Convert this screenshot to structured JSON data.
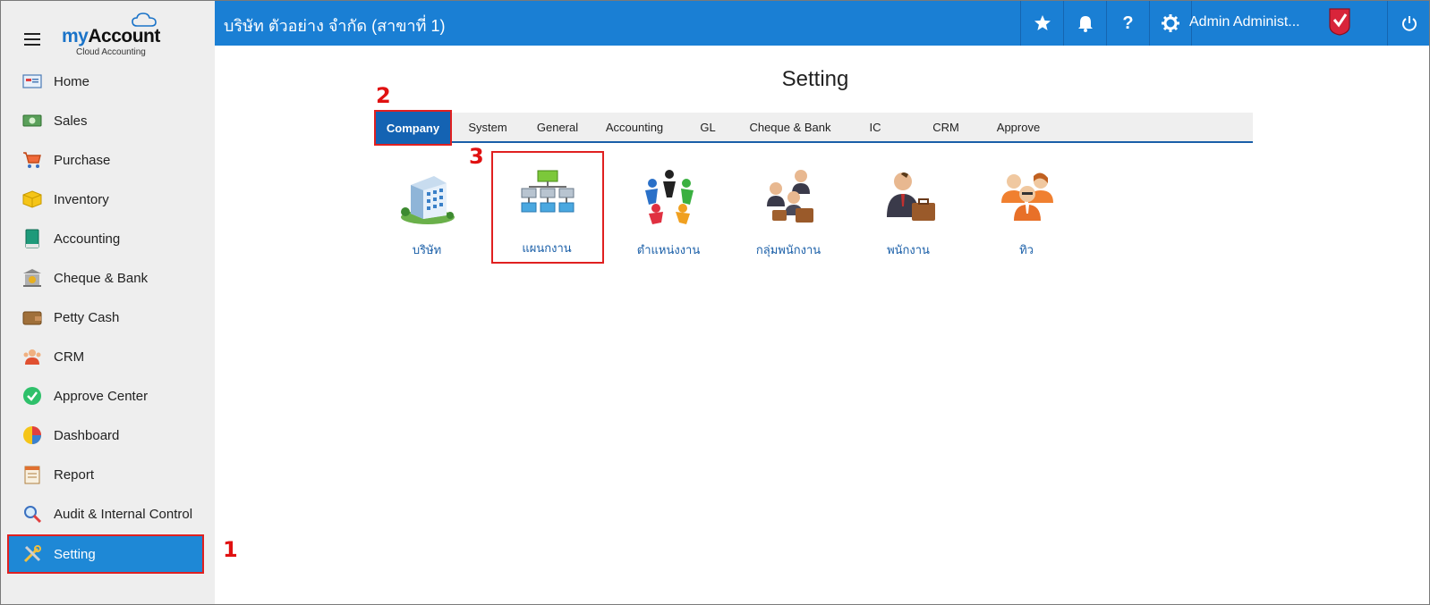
{
  "brand": {
    "name_prefix": "my",
    "name_suffix": "Account",
    "subtitle": "Cloud Accounting"
  },
  "sidebar": {
    "items": [
      {
        "label": "Home",
        "icon": "home-icon"
      },
      {
        "label": "Sales",
        "icon": "cash-icon"
      },
      {
        "label": "Purchase",
        "icon": "cart-icon"
      },
      {
        "label": "Inventory",
        "icon": "box-icon"
      },
      {
        "label": "Accounting",
        "icon": "book-icon"
      },
      {
        "label": "Cheque & Bank",
        "icon": "bank-icon"
      },
      {
        "label": "Petty Cash",
        "icon": "wallet-icon"
      },
      {
        "label": "CRM",
        "icon": "people-icon"
      },
      {
        "label": "Approve Center",
        "icon": "check-circle-icon"
      },
      {
        "label": "Dashboard",
        "icon": "pie-chart-icon"
      },
      {
        "label": "Report",
        "icon": "report-icon"
      },
      {
        "label": "Audit & Internal Control",
        "icon": "magnifier-icon"
      },
      {
        "label": "Setting",
        "icon": "tools-icon"
      }
    ],
    "active": "Setting"
  },
  "topbar": {
    "company": "บริษัท ตัวอย่าง จำกัด (สาขาที่ 1)",
    "user": "Admin Administ...",
    "icons": [
      "star-icon",
      "bell-icon",
      "help-icon",
      "gear-icon",
      "power-icon"
    ]
  },
  "annotations": {
    "one": "1",
    "two": "2",
    "three": "3"
  },
  "main": {
    "title": "Setting",
    "tabs": [
      "Company",
      "System",
      "General",
      "Accounting",
      "GL",
      "Cheque & Bank",
      "IC",
      "CRM",
      "Approve"
    ],
    "active_tab": "Company",
    "tiles": [
      {
        "label": "บริษัท",
        "icon": "building-icon"
      },
      {
        "label": "แผนกงาน",
        "icon": "org-chart-icon"
      },
      {
        "label": "ตำแหน่งงาน",
        "icon": "team-circle-icon"
      },
      {
        "label": "กลุ่มพนักงาน",
        "icon": "employee-group-icon"
      },
      {
        "label": "พนักงาน",
        "icon": "employee-icon"
      },
      {
        "label": "ทิว",
        "icon": "staff-team-icon"
      }
    ]
  },
  "colors": {
    "topbar": "#1a7fd4",
    "active_menu": "#1e88d6",
    "active_tab": "#1463b3",
    "annotation": "#e01010",
    "link": "#1a5fa8"
  }
}
